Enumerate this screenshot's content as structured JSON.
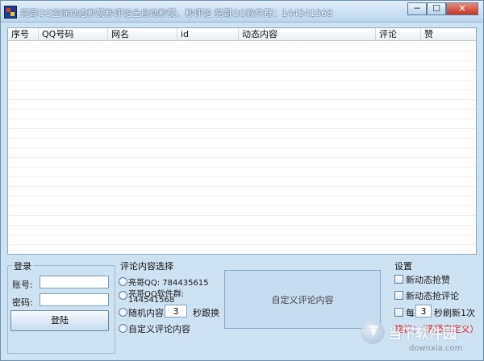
{
  "window": {
    "title": "亮哥QQ空间动态秒赞秒评论全自动秒赞、秒评论 亮哥QQ软件群：144541568",
    "minimize_glyph": "─",
    "maximize_glyph": "☐",
    "close_glyph": "✕"
  },
  "grid": {
    "columns": [
      "序号",
      "QQ号码",
      "网名",
      "id",
      "动态内容",
      "评论",
      "赞"
    ]
  },
  "login": {
    "group_title": "登录",
    "account_label": "账号:",
    "account_value": "",
    "password_label": "密码:",
    "password_value": "",
    "login_button": "登陆"
  },
  "comment_select": {
    "group_title": "评论内容选择",
    "option_qq": "亮哥QQ: 784435615",
    "option_group_line1": "亮哥QQ软件群:",
    "option_group_line2": "144541568",
    "option_random_prefix": "随机内容",
    "random_value": "3",
    "option_random_suffix": "秒跟换",
    "option_custom": "自定义评论内容",
    "custom_panel_text": "自定义评论内容"
  },
  "settings": {
    "group_title": "设置",
    "new_like": "新动态抢赞",
    "new_comment": "新动态抢评论",
    "every_prefix": "每",
    "every_value": "3",
    "every_suffix": "秒刷新1次",
    "suggestion": "建议：（选择自定义）",
    "suggestion_color": "#e0201b"
  },
  "watermark": {
    "text": "当下软件园",
    "url": "downxia.com"
  }
}
